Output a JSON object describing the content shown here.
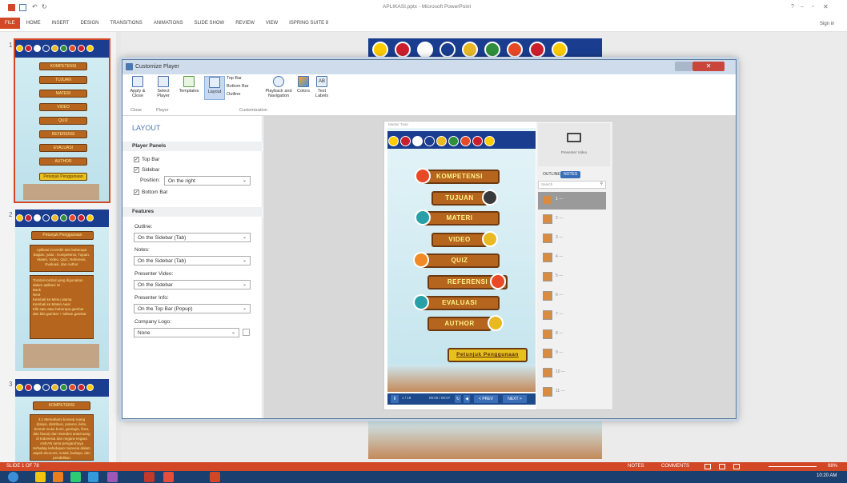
{
  "window": {
    "title": "APLIKASI.pptx - Microsoft PowerPoint",
    "help": "?",
    "sign_in": "Sign in"
  },
  "ribbon": {
    "tabs": [
      "FILE",
      "HOME",
      "INSERT",
      "DESIGN",
      "TRANSITIONS",
      "ANIMATIONS",
      "SLIDE SHOW",
      "REVIEW",
      "VIEW",
      "ISPRING SUITE 8"
    ]
  },
  "slides_panel": {
    "numbers": [
      "1",
      "2",
      "3"
    ],
    "slide1_items": [
      "KOMPETENSI",
      "TUJUAN",
      "MATERI",
      "VIDEO",
      "QUIZ",
      "REFERENSI",
      "EVALUASI",
      "AUTHOR",
      "Petunjuk Penggunaan"
    ],
    "slide2_title": "Petunjuk Penggunaan",
    "slide2_text1": "Aplikasi ini terdiri dari beberapa bagian, yaitu : Kompetensi, Tujuan, Materi, Video, Quiz, Referensi, Evaluasi, dan Author",
    "slide2_text2": "Tombol-tombol yang digunakan dalam aplikasi ini :",
    "slide2_buttons": [
      "Back",
      "Next",
      "Kembali ke Menu utama",
      "Kembali ke Materi Awal",
      "Klik satu atau beberapa gambar dan bila gambar + tulisan gambar"
    ],
    "slide3_title": "KOMPETENSI",
    "slide3_text": "3.1 Memahami konsep ruang (lokasi, distribusi, potensi, iklim, bentuk muka bumi, geologis, flora, dan fauna) dan interaksi antarruang di Indonesia dan negara-negara ASEAN serta pengaruhnya terhadap kehidupan manusia dalam aspek ekonomi, sosial, budaya, dan pendidikan"
  },
  "dialog": {
    "title": "Customize Player",
    "toolbar": {
      "apply_close": "Apply & Close",
      "select_player": "Select Player",
      "templates": "Templates",
      "layout": "Layout",
      "top_bar": "Top Bar",
      "bottom_bar": "Bottom Bar",
      "outline": "Outline",
      "playback": "Playback and Navigation",
      "colors": "Colors",
      "text_labels": "Text Labels",
      "groups": [
        "Close",
        "Player",
        "Customization"
      ]
    },
    "left": {
      "heading": "LAYOUT",
      "player_panels": "Player Panels",
      "top_bar": "Top Bar",
      "sidebar": "Sidebar",
      "position_label": "Position:",
      "position_value": "On the right",
      "bottom_bar": "Bottom Bar",
      "features": "Features",
      "outline_label": "Outline:",
      "outline_value": "On the Sidebar (Tab)",
      "notes_label": "Notes:",
      "notes_value": "On the Sidebar (Tab)",
      "presenter_video_label": "Presenter Video:",
      "presenter_video_value": "On the Sidebar",
      "presenter_info_label": "Presenter Info:",
      "presenter_info_value": "On the Top Bar (Popup)",
      "company_logo_label": "Company Logo:",
      "company_logo_value": "None"
    },
    "preview": {
      "title_bar": "Master Tuan",
      "menu_items": [
        "KOMPETENSI",
        "TUJUAN",
        "MATERI",
        "VIDEO",
        "QUIZ",
        "REFERENSI",
        "EVALUASI",
        "AUTHOR"
      ],
      "petunjuk": "Petunjuk Penggunaan",
      "presenter_video": "Presenter Video",
      "outline_tab": "OUTLINE",
      "notes_tab": "NOTES",
      "search": "Search",
      "outline_rows": [
        "1 ---",
        "2 ---",
        "3 ---",
        "4 ---",
        "5 ---",
        "6 ---",
        "7 ---",
        "8 ---",
        "9 ---",
        "10 ---",
        "11 ---"
      ],
      "slide_counter": "1 / 19",
      "time": "00:00 / 00:07",
      "prev": "< PREV",
      "next": "NEXT >"
    }
  },
  "status_bar": {
    "slide": "SLIDE 1 OF 78",
    "notes": "NOTES",
    "comments": "COMMENTS",
    "zoom": "98%"
  },
  "taskbar": {
    "time": "10:20 AM"
  },
  "colors": {
    "accent": "#d24726",
    "wood": "#b5651d",
    "player_blue": "#1c4a8c"
  }
}
